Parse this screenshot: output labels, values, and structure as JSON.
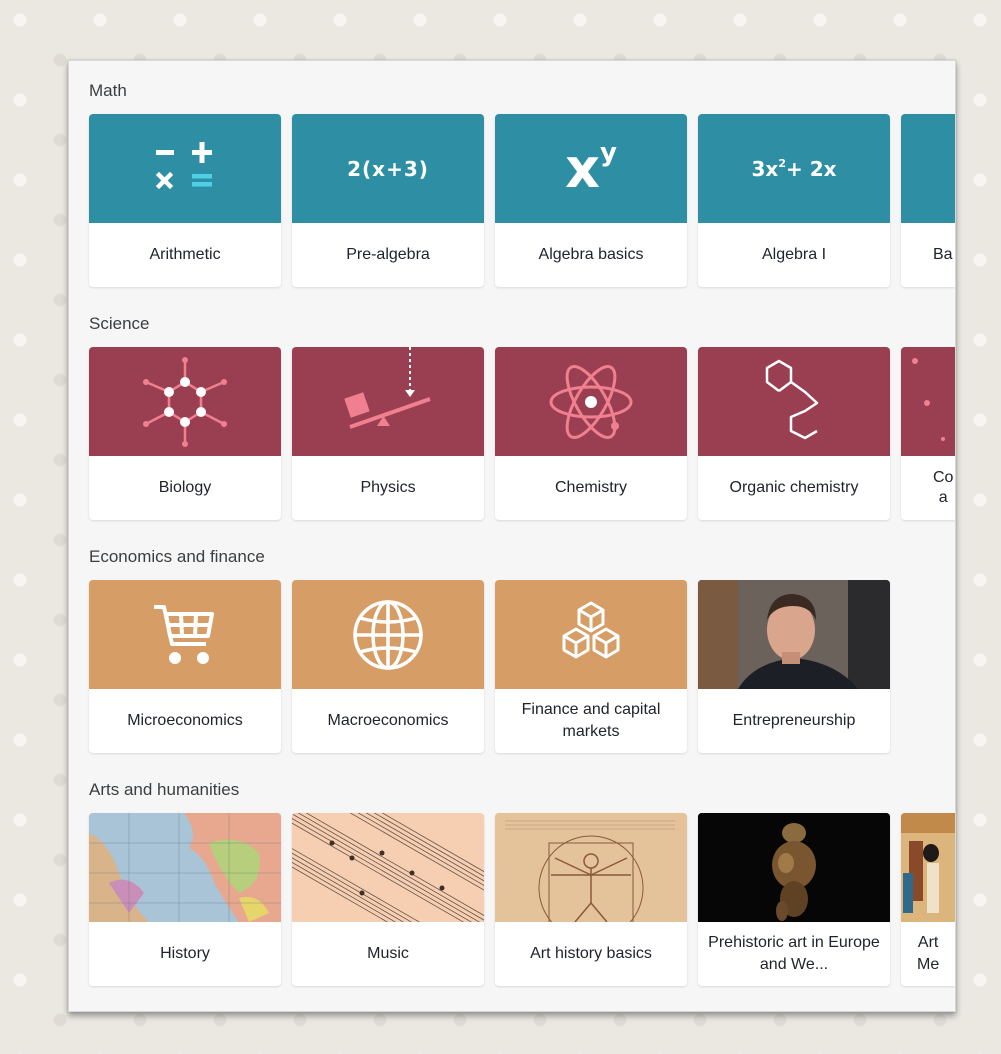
{
  "sections": [
    {
      "title": "Math",
      "cards": [
        {
          "label": "Arithmetic",
          "icon": "arithmetic-icon"
        },
        {
          "label": "Pre-algebra",
          "icon_text": "2(x+3)"
        },
        {
          "label": "Algebra basics",
          "icon_text": "x",
          "icon_sup": "y"
        },
        {
          "label": "Algebra I",
          "icon_text": "3x",
          "icon_sup": "2",
          "icon_text2": "+ 2x"
        },
        {
          "label": "Ba"
        }
      ]
    },
    {
      "title": "Science",
      "cards": [
        {
          "label": "Biology",
          "icon": "molecule-icon"
        },
        {
          "label": "Physics",
          "icon": "lever-icon"
        },
        {
          "label": "Chemistry",
          "icon": "atom-icon"
        },
        {
          "label": "Organic chemistry",
          "icon": "hexagon-structure-icon"
        },
        {
          "label": "Co\na"
        }
      ]
    },
    {
      "title": "Economics and finance",
      "cards": [
        {
          "label": "Microeconomics",
          "icon": "shopping-cart-icon"
        },
        {
          "label": "Macroeconomics",
          "icon": "globe-icon"
        },
        {
          "label": "Finance and capital markets",
          "icon": "stacked-cubes-icon"
        },
        {
          "label": "Entrepreneurship",
          "image": "portrait-photo"
        }
      ]
    },
    {
      "title": "Arts and humanities",
      "cards": [
        {
          "label": "History",
          "image": "world-map-image"
        },
        {
          "label": "Music",
          "image": "sheet-music-image"
        },
        {
          "label": "Art history basics",
          "image": "vitruvian-man-image"
        },
        {
          "label": "Prehistoric art in Europe and We...",
          "image": "venus-figurine-image"
        },
        {
          "label": "Art\nMe",
          "image": "egyptian-art-image"
        }
      ]
    }
  ],
  "colors": {
    "math": "#2e8fa4",
    "science": "#9a3f52",
    "economics": "#d69e66",
    "science_icon": "#f0808f"
  }
}
